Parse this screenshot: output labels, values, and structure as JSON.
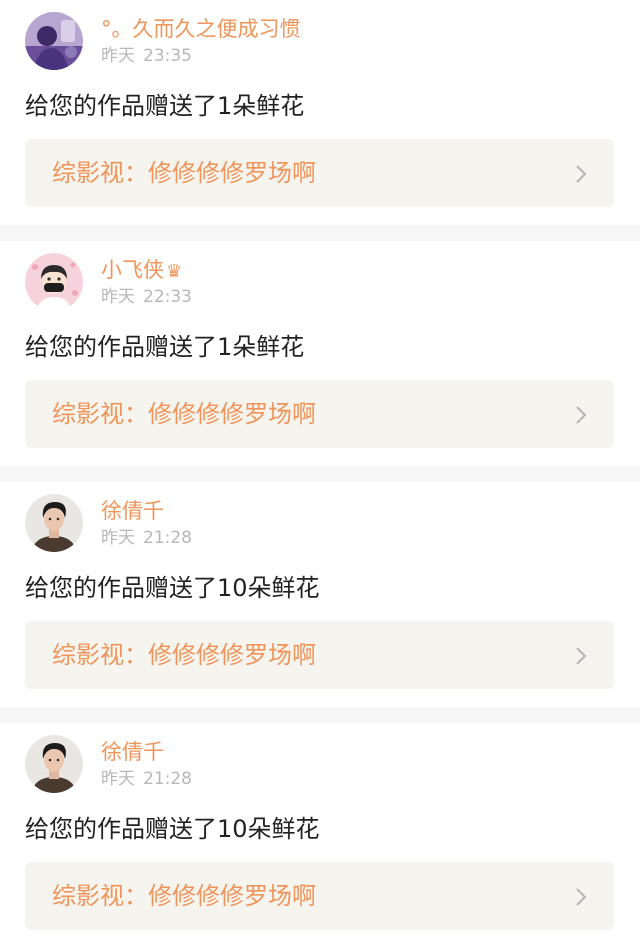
{
  "colors": {
    "accent": "#f0955a",
    "time": "#b8b8b8",
    "text": "#222222",
    "work_bg": "#f5f4ef",
    "separator": "#f6f6f6"
  },
  "notifications": [
    {
      "username": "°。久而久之便成习惯",
      "badge": "",
      "day": "昨天",
      "time": "23:35",
      "message": "给您的作品赠送了1朵鲜花",
      "work_category": "综影视",
      "work_colon": "：",
      "work_title": "修修修修罗场啊",
      "avatar_icon": "purple-photo-avatar"
    },
    {
      "username": "小飞侠",
      "badge": "♛",
      "day": "昨天",
      "time": "22:33",
      "message": "给您的作品赠送了1朵鲜花",
      "work_category": "综影视",
      "work_colon": "：",
      "work_title": "修修修修罗场啊",
      "avatar_icon": "cartoon-masked-avatar"
    },
    {
      "username": "徐倩千",
      "badge": "",
      "day": "昨天",
      "time": "21:28",
      "message": "给您的作品赠送了10朵鲜花",
      "work_category": "综影视",
      "work_colon": "：",
      "work_title": "修修修修罗场啊",
      "avatar_icon": "portrait-avatar"
    },
    {
      "username": "徐倩千",
      "badge": "",
      "day": "昨天",
      "time": "21:28",
      "message": "给您的作品赠送了10朵鲜花",
      "work_category": "综影视",
      "work_colon": "：",
      "work_title": "修修修修罗场啊",
      "avatar_icon": "portrait-avatar"
    }
  ]
}
